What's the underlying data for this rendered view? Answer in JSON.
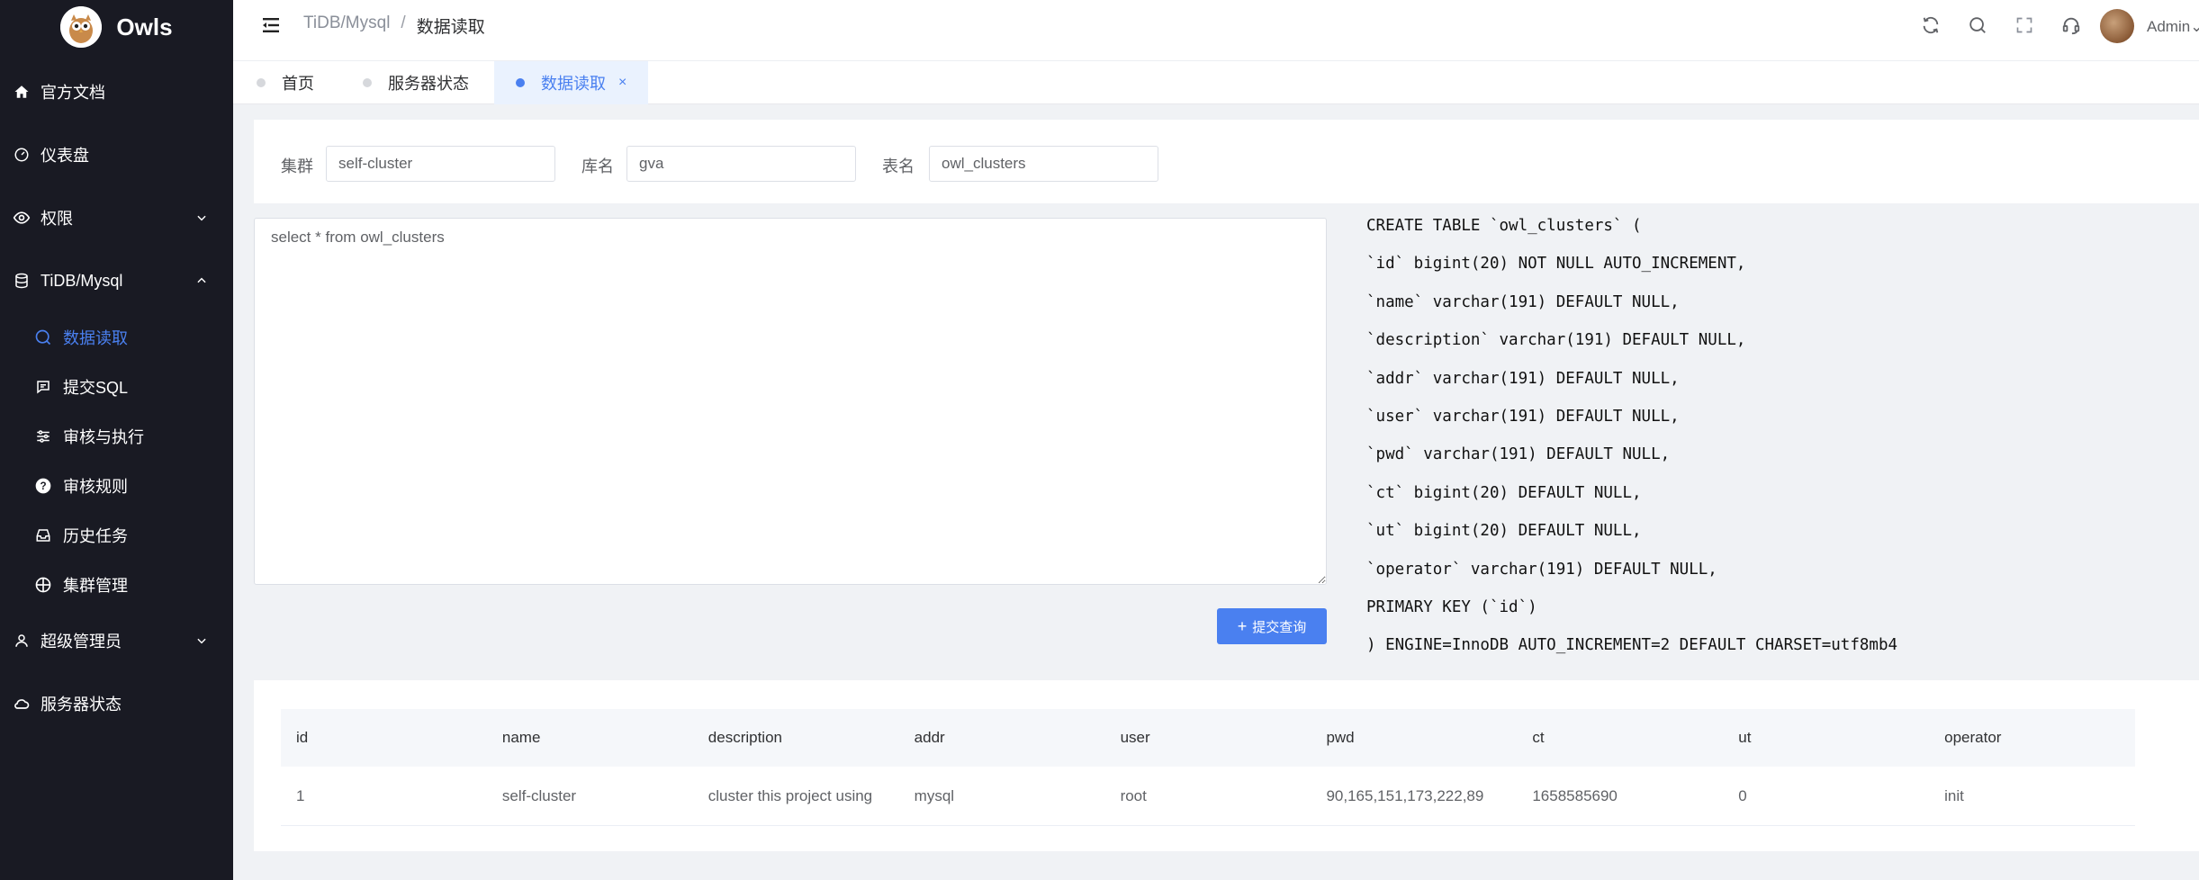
{
  "app": {
    "name": "Owls"
  },
  "sidebar": {
    "items": [
      {
        "label": "官方文档",
        "icon": "home-icon"
      },
      {
        "label": "仪表盘",
        "icon": "dashboard-icon"
      },
      {
        "label": "权限",
        "icon": "eye-icon",
        "expandable": true,
        "expanded": false
      },
      {
        "label": "TiDB/Mysql",
        "icon": "database-icon",
        "expandable": true,
        "expanded": true
      },
      {
        "label": "数据读取",
        "icon": "search-icon",
        "sub": true,
        "active": true
      },
      {
        "label": "提交SQL",
        "icon": "message-icon",
        "sub": true
      },
      {
        "label": "审核与执行",
        "icon": "sliders-icon",
        "sub": true
      },
      {
        "label": "审核规则",
        "icon": "question-icon",
        "sub": true
      },
      {
        "label": "历史任务",
        "icon": "inbox-icon",
        "sub": true
      },
      {
        "label": "集群管理",
        "icon": "crosshair-icon",
        "sub": true
      },
      {
        "label": "超级管理员",
        "icon": "user-icon",
        "expandable": true,
        "expanded": false
      },
      {
        "label": "服务器状态",
        "icon": "cloud-icon"
      }
    ]
  },
  "header": {
    "breadcrumb": {
      "parent": "TiDB/Mysql",
      "separator": "/",
      "current": "数据读取"
    },
    "user": "Admin"
  },
  "tabs": [
    {
      "label": "首页"
    },
    {
      "label": "服务器状态"
    },
    {
      "label": "数据读取",
      "active": true,
      "close": "×"
    }
  ],
  "filters": {
    "cluster_label": "集群",
    "cluster_value": "self-cluster",
    "db_label": "库名",
    "db_value": "gva",
    "table_label": "表名",
    "table_value": "owl_clusters"
  },
  "editor": {
    "query": "select * from owl_clusters",
    "submit_label": "提交查询"
  },
  "ddl": [
    "CREATE TABLE `owl_clusters` (",
    "`id` bigint(20) NOT NULL AUTO_INCREMENT,",
    "`name` varchar(191) DEFAULT NULL,",
    "`description` varchar(191) DEFAULT NULL,",
    "`addr` varchar(191) DEFAULT NULL,",
    "`user` varchar(191) DEFAULT NULL,",
    "`pwd` varchar(191) DEFAULT NULL,",
    "`ct` bigint(20) DEFAULT NULL,",
    "`ut` bigint(20) DEFAULT NULL,",
    "`operator` varchar(191) DEFAULT NULL,",
    "PRIMARY KEY (`id`)",
    ") ENGINE=InnoDB AUTO_INCREMENT=2 DEFAULT CHARSET=utf8mb4"
  ],
  "results": {
    "columns": [
      "id",
      "name",
      "description",
      "addr",
      "user",
      "pwd",
      "ct",
      "ut",
      "operator"
    ],
    "rows": [
      [
        "1",
        "self-cluster",
        "cluster this project using",
        "mysql",
        "root",
        "90,165,151,173,222,89",
        "1658585690",
        "0",
        "init"
      ]
    ]
  },
  "colors": {
    "sidebar_bg": "#191a23",
    "accent": "#4a80f0",
    "page_bg": "#f0f2f5"
  }
}
